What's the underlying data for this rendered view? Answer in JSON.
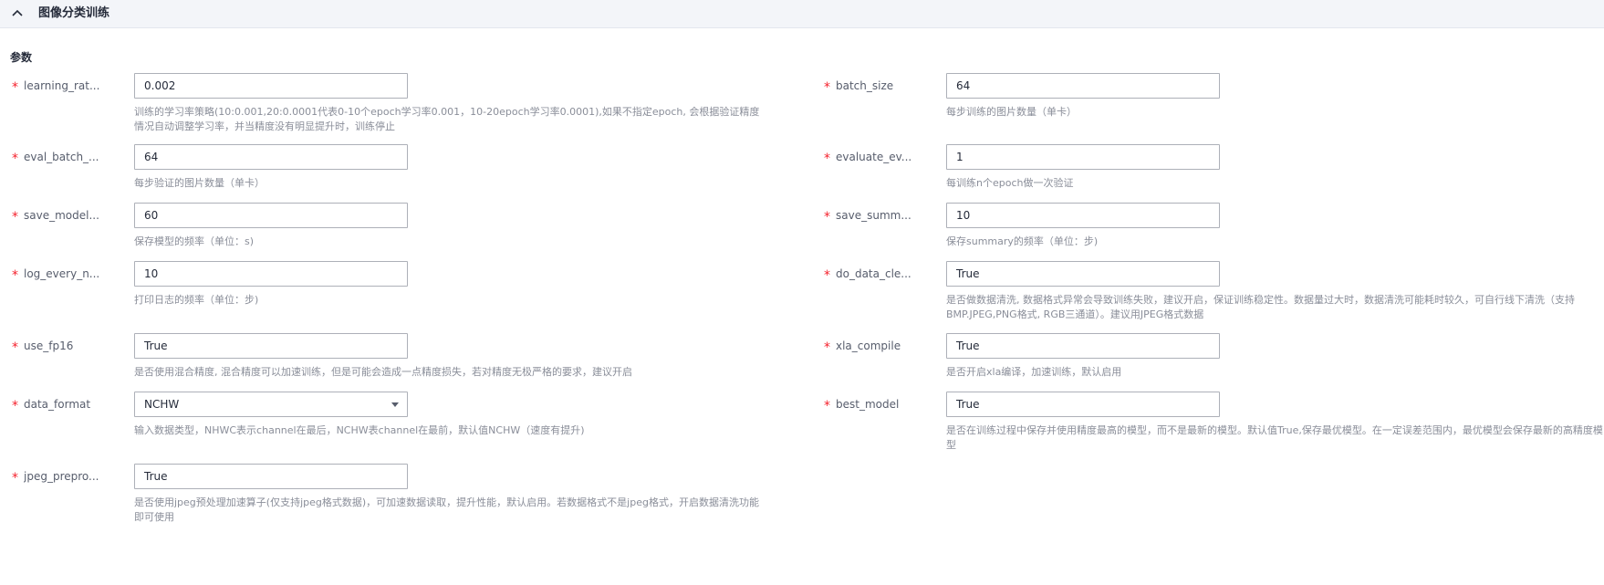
{
  "header": {
    "title": "图像分类训练"
  },
  "section": {
    "title": "参数"
  },
  "params": {
    "learning_rate": {
      "label": "learning_rat...",
      "value": "0.002",
      "help": "训练的学习率策略(10:0.001,20:0.0001代表0-10个epoch学习率0.001，10-20epoch学习率0.0001),如果不指定epoch, 会根据验证精度情况自动调整学习率，并当精度没有明显提升时，训练停止"
    },
    "batch_size": {
      "label": "batch_size",
      "value": "64",
      "help": "每步训练的图片数量（单卡）"
    },
    "eval_batch": {
      "label": "eval_batch_...",
      "value": "64",
      "help": "每步验证的图片数量（单卡）"
    },
    "evaluate_every": {
      "label": "evaluate_ev...",
      "value": "1",
      "help": "每训练n个epoch做一次验证"
    },
    "save_model": {
      "label": "save_model...",
      "value": "60",
      "help": "保存模型的频率（单位：s)"
    },
    "save_summary": {
      "label": "save_summ...",
      "value": "10",
      "help": "保存summary的频率（单位：步)"
    },
    "log_every": {
      "label": "log_every_n...",
      "value": "10",
      "help": "打印日志的频率（单位：步)"
    },
    "do_data_clean": {
      "label": "do_data_cle...",
      "value": "True",
      "help": "是否做数据清洗, 数据格式异常会导致训练失败，建议开启，保证训练稳定性。数据量过大时，数据清洗可能耗时较久，可自行线下清洗（支持BMP.JPEG,PNG格式, RGB三通道）。建议用JPEG格式数据"
    },
    "use_fp16": {
      "label": "use_fp16",
      "value": "True",
      "help": "是否使用混合精度, 混合精度可以加速训练，但是可能会造成一点精度损失，若对精度无极严格的要求，建议开启"
    },
    "xla_compile": {
      "label": "xla_compile",
      "value": "True",
      "help": "是否开启xla编译，加速训练，默认启用"
    },
    "data_format": {
      "label": "data_format",
      "value": "NCHW",
      "help": "输入数据类型，NHWC表示channel在最后，NCHW表channel在最前，默认值NCHW（速度有提升)"
    },
    "best_model": {
      "label": "best_model",
      "value": "True",
      "help": "是否在训练过程中保存并使用精度最高的模型，而不是最新的模型。默认值True,保存最优模型。在一定误差范围内，最优模型会保存最新的高精度模型"
    },
    "jpeg_preprocess": {
      "label": "jpeg_prepro...",
      "value": "True",
      "help": "是否使用jpeg预处理加速算子(仅支持jpeg格式数据)，可加速数据读取，提升性能，默认启用。若数据格式不是jpeg格式，开启数据清洗功能即可使用"
    }
  },
  "colors": {
    "required_star": "#f5222d",
    "header_bg": "#f3f5f9",
    "help_text": "#8a8e99",
    "input_border": "#adb0b8"
  },
  "icons": {
    "collapse": "chevron-up-icon",
    "select": "caret-down-icon"
  }
}
